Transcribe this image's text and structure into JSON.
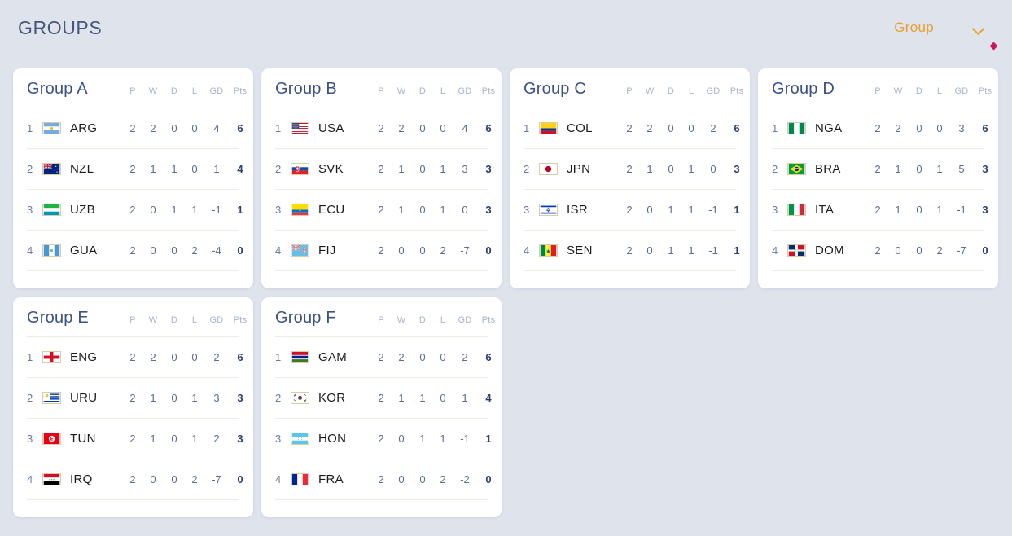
{
  "header": {
    "title": "GROUPS",
    "filter_label": "Group",
    "chevron_icon": "chevron-down-icon",
    "accent_line_color": "#d4145a",
    "title_color": "#48567c",
    "filter_color": "#e8a12c"
  },
  "columns": [
    "P",
    "W",
    "D",
    "L",
    "GD",
    "Pts"
  ],
  "groups": [
    {
      "name": "Group A",
      "rows": [
        {
          "rank": "1",
          "code": "ARG",
          "flag": "ar",
          "p": "2",
          "w": "2",
          "d": "0",
          "l": "0",
          "gd": "4",
          "pts": "6"
        },
        {
          "rank": "2",
          "code": "NZL",
          "flag": "nz",
          "p": "2",
          "w": "1",
          "d": "1",
          "l": "0",
          "gd": "1",
          "pts": "4"
        },
        {
          "rank": "3",
          "code": "UZB",
          "flag": "uz",
          "p": "2",
          "w": "0",
          "d": "1",
          "l": "1",
          "gd": "-1",
          "pts": "1"
        },
        {
          "rank": "4",
          "code": "GUA",
          "flag": "gt",
          "p": "2",
          "w": "0",
          "d": "0",
          "l": "2",
          "gd": "-4",
          "pts": "0"
        }
      ]
    },
    {
      "name": "Group B",
      "rows": [
        {
          "rank": "1",
          "code": "USA",
          "flag": "us",
          "p": "2",
          "w": "2",
          "d": "0",
          "l": "0",
          "gd": "4",
          "pts": "6"
        },
        {
          "rank": "2",
          "code": "SVK",
          "flag": "sk",
          "p": "2",
          "w": "1",
          "d": "0",
          "l": "1",
          "gd": "3",
          "pts": "3"
        },
        {
          "rank": "3",
          "code": "ECU",
          "flag": "ec",
          "p": "2",
          "w": "1",
          "d": "0",
          "l": "1",
          "gd": "0",
          "pts": "3"
        },
        {
          "rank": "4",
          "code": "FIJ",
          "flag": "fj",
          "p": "2",
          "w": "0",
          "d": "0",
          "l": "2",
          "gd": "-7",
          "pts": "0"
        }
      ]
    },
    {
      "name": "Group C",
      "rows": [
        {
          "rank": "1",
          "code": "COL",
          "flag": "co",
          "p": "2",
          "w": "2",
          "d": "0",
          "l": "0",
          "gd": "2",
          "pts": "6"
        },
        {
          "rank": "2",
          "code": "JPN",
          "flag": "jp",
          "p": "2",
          "w": "1",
          "d": "0",
          "l": "1",
          "gd": "0",
          "pts": "3"
        },
        {
          "rank": "3",
          "code": "ISR",
          "flag": "il",
          "p": "2",
          "w": "0",
          "d": "1",
          "l": "1",
          "gd": "-1",
          "pts": "1"
        },
        {
          "rank": "4",
          "code": "SEN",
          "flag": "sn",
          "p": "2",
          "w": "0",
          "d": "1",
          "l": "1",
          "gd": "-1",
          "pts": "1"
        }
      ]
    },
    {
      "name": "Group D",
      "rows": [
        {
          "rank": "1",
          "code": "NGA",
          "flag": "ng",
          "p": "2",
          "w": "2",
          "d": "0",
          "l": "0",
          "gd": "3",
          "pts": "6"
        },
        {
          "rank": "2",
          "code": "BRA",
          "flag": "br",
          "p": "2",
          "w": "1",
          "d": "0",
          "l": "1",
          "gd": "5",
          "pts": "3"
        },
        {
          "rank": "3",
          "code": "ITA",
          "flag": "it",
          "p": "2",
          "w": "1",
          "d": "0",
          "l": "1",
          "gd": "-1",
          "pts": "3"
        },
        {
          "rank": "4",
          "code": "DOM",
          "flag": "do",
          "p": "2",
          "w": "0",
          "d": "0",
          "l": "2",
          "gd": "-7",
          "pts": "0"
        }
      ]
    },
    {
      "name": "Group E",
      "rows": [
        {
          "rank": "1",
          "code": "ENG",
          "flag": "en",
          "p": "2",
          "w": "2",
          "d": "0",
          "l": "0",
          "gd": "2",
          "pts": "6"
        },
        {
          "rank": "2",
          "code": "URU",
          "flag": "uy",
          "p": "2",
          "w": "1",
          "d": "0",
          "l": "1",
          "gd": "3",
          "pts": "3"
        },
        {
          "rank": "3",
          "code": "TUN",
          "flag": "tn",
          "p": "2",
          "w": "1",
          "d": "0",
          "l": "1",
          "gd": "2",
          "pts": "3"
        },
        {
          "rank": "4",
          "code": "IRQ",
          "flag": "iq",
          "p": "2",
          "w": "0",
          "d": "0",
          "l": "2",
          "gd": "-7",
          "pts": "0"
        }
      ]
    },
    {
      "name": "Group F",
      "rows": [
        {
          "rank": "1",
          "code": "GAM",
          "flag": "gm",
          "p": "2",
          "w": "2",
          "d": "0",
          "l": "0",
          "gd": "2",
          "pts": "6"
        },
        {
          "rank": "2",
          "code": "KOR",
          "flag": "kr",
          "p": "2",
          "w": "1",
          "d": "1",
          "l": "0",
          "gd": "1",
          "pts": "4"
        },
        {
          "rank": "3",
          "code": "HON",
          "flag": "hn",
          "p": "2",
          "w": "0",
          "d": "1",
          "l": "1",
          "gd": "-1",
          "pts": "1"
        },
        {
          "rank": "4",
          "code": "FRA",
          "flag": "fr",
          "p": "2",
          "w": "0",
          "d": "0",
          "l": "2",
          "gd": "-2",
          "pts": "0"
        }
      ]
    }
  ]
}
